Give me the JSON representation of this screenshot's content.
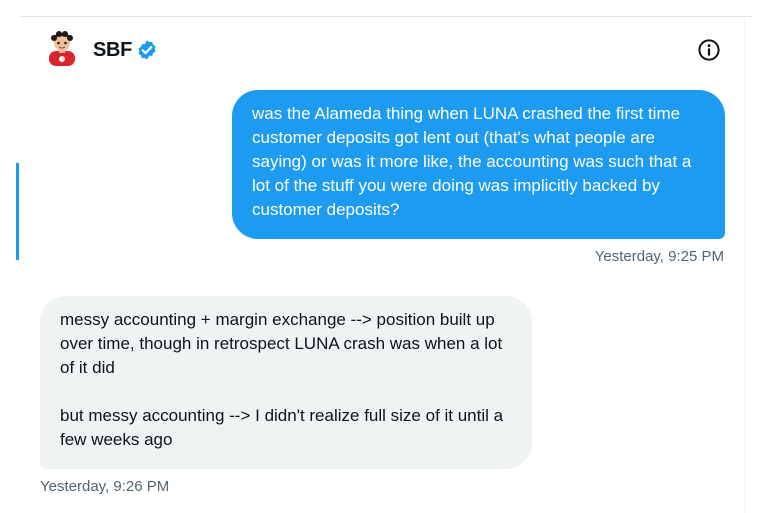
{
  "conversation": {
    "name": "SBF",
    "verified": true,
    "info_icon": "info-circle-icon",
    "avatar_icon": "cartoon-avatar-icon"
  },
  "messages": [
    {
      "direction": "sent",
      "text": "was the Alameda thing when LUNA crashed the first time customer deposits got lent out (that's what people are saying) or was it more like, the accounting was such that a lot of the stuff you were doing was implicitly backed by customer deposits?",
      "timestamp": "Yesterday, 9:25 PM"
    },
    {
      "direction": "received",
      "text": "messy accounting + margin exchange --> position built up over time, though in retrospect LUNA crash was when a lot of it did\n\nbut messy accounting --> I didn't realize full size of it until a few weeks ago",
      "timestamp": "Yesterday, 9:26 PM"
    }
  ],
  "colors": {
    "sent_bubble": "#1d9bf0",
    "received_bubble": "#eff3f4",
    "timestamp_text": "#536471",
    "verified_badge": "#1d9bf0"
  }
}
